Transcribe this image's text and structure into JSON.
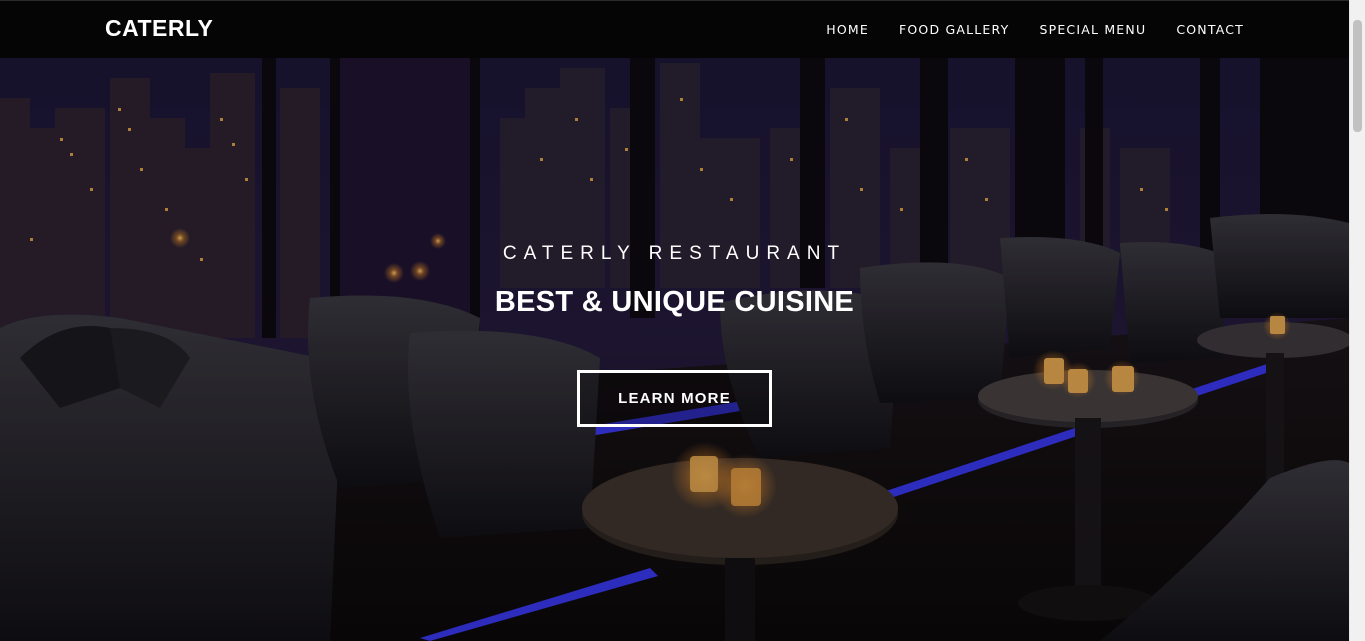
{
  "navbar": {
    "brand": "CATERLY",
    "links": [
      {
        "label": "HOME"
      },
      {
        "label": "FOOD GALLERY"
      },
      {
        "label": "SPECIAL MENU"
      },
      {
        "label": "CONTACT"
      }
    ]
  },
  "hero": {
    "subtitle": "CATERLY RESTAURANT",
    "title": "BEST & UNIQUE CUISINE",
    "button_label": "LEARN MORE",
    "image_subject": "night-lounge-with-city-skyline"
  },
  "colors": {
    "nav_background": "#050505",
    "text": "#ffffff",
    "accent_light": "#3b3bff"
  }
}
